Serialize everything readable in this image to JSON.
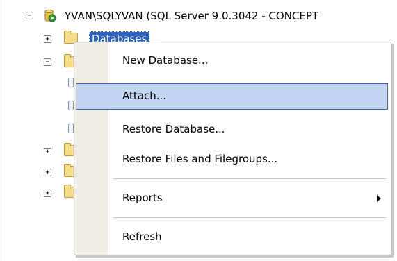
{
  "tree": {
    "server_label": "YVAN\\SQLYVAN (SQL Server 9.0.3042 - CONCEPT",
    "databases_label": "Databases"
  },
  "context_menu": {
    "items": [
      {
        "label": "New Database..."
      },
      {
        "label": "Attach...",
        "highlighted": true
      },
      {
        "label": "Restore Database..."
      },
      {
        "label": "Restore Files and Filegroups..."
      },
      {
        "label": "Reports",
        "has_submenu": true
      },
      {
        "label": "Refresh"
      }
    ]
  }
}
